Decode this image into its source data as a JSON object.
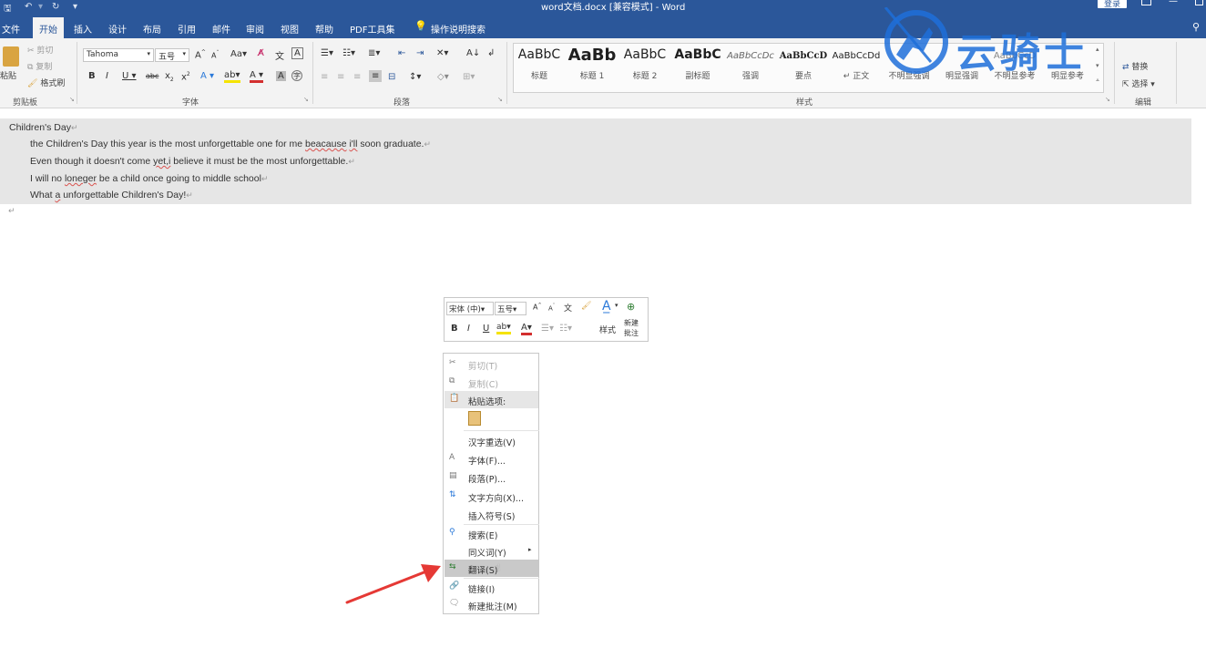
{
  "titlebar": {
    "title": "word文档.docx [兼容模式] - Word",
    "login": "登录",
    "restore_icon": "ribbon-display-icon",
    "minimize": "—",
    "close_icon": "close-icon"
  },
  "tabs": [
    "文件",
    "开始",
    "插入",
    "设计",
    "布局",
    "引用",
    "邮件",
    "审阅",
    "视图",
    "帮助",
    "PDF工具集"
  ],
  "tellme": "操作说明搜索",
  "share_icon": "person-icon",
  "clipboard": {
    "paste": "粘贴",
    "cut": "剪切",
    "copy": "复制",
    "format_painter": "格式刷",
    "group": "剪贴板"
  },
  "font_group": {
    "font_name": "Tahoma",
    "font_size": "五号",
    "group": "字体"
  },
  "paragraph_group": {
    "group": "段落"
  },
  "styles": {
    "group": "样式",
    "items": [
      {
        "sample": "AaBbC",
        "name": "标题"
      },
      {
        "sample": "AaBb",
        "name": "标题 1"
      },
      {
        "sample": "AaBbC",
        "name": "标题 2"
      },
      {
        "sample": "AaBbC",
        "name": "副标题"
      },
      {
        "sample": "AaBbCcDc",
        "name": "强调"
      },
      {
        "sample": "AaBbCcD",
        "name": "要点"
      },
      {
        "sample": "AaBbCcDd",
        "name": "↵ 正文"
      },
      {
        "sample": "",
        "name": "不明显强调"
      },
      {
        "sample": "",
        "name": "明显强调"
      },
      {
        "sample": "AaBbCcD",
        "name": "不明显参考"
      },
      {
        "sample": "",
        "name": "明显参考"
      }
    ]
  },
  "editing": {
    "replace": "替换",
    "select": "选择",
    "group": "编辑"
  },
  "watermark": {
    "text": "云骑士"
  },
  "document": {
    "lines": [
      {
        "text": "Children's Day"
      },
      {
        "pre": "the Children's Day this year is the most unforgettable one for me ",
        "err1": "beacause",
        "mid": " ",
        "err2": "i'll",
        "post": " soon graduate."
      },
      {
        "pre": "Even though it doesn't come ",
        "err1": "yet,i",
        "post": " believe it must be the most unforgettable."
      },
      {
        "pre": "I will no ",
        "err1": "loneger",
        "post": " be a child once going to middle school"
      },
      {
        "pre": "What ",
        "err1": "a",
        "post": " unforgettable Children's Day!"
      }
    ]
  },
  "minitoolbar": {
    "font": "宋体 (中)",
    "size": "五号",
    "styles": "样式",
    "new_comment_1": "新建",
    "new_comment_2": "批注"
  },
  "context_menu": {
    "items": [
      {
        "label": "剪切(T)",
        "icon": "scissors-icon",
        "disabled": true
      },
      {
        "label": "复制(C)",
        "icon": "copy-icon",
        "disabled": true
      },
      {
        "label": "粘贴选项:",
        "icon": "paste-icon",
        "disabled": false
      },
      {
        "label": "汉字重选(V)",
        "icon": "",
        "disabled": false
      },
      {
        "label": "字体(F)...",
        "icon": "font-icon",
        "disabled": false
      },
      {
        "label": "段落(P)...",
        "icon": "paragraph-icon",
        "disabled": false
      },
      {
        "label": "文字方向(X)...",
        "icon": "text-direction-icon",
        "disabled": false
      },
      {
        "label": "插入符号(S)",
        "icon": "",
        "disabled": false
      },
      {
        "label": "搜索(E)",
        "icon": "search-icon",
        "disabled": false
      },
      {
        "label": "同义词(Y)",
        "icon": "",
        "disabled": false
      },
      {
        "label": "翻译(S)",
        "icon": "translate-icon",
        "disabled": false
      },
      {
        "label": "链接(I)",
        "icon": "link-icon",
        "disabled": false
      },
      {
        "label": "新建批注(M)",
        "icon": "comment-icon",
        "disabled": false
      }
    ]
  },
  "colors": {
    "brand": "#2b579a",
    "selection": "#e6e6e6",
    "arrow": "#e53935",
    "watermark": "#1e6fd9"
  }
}
